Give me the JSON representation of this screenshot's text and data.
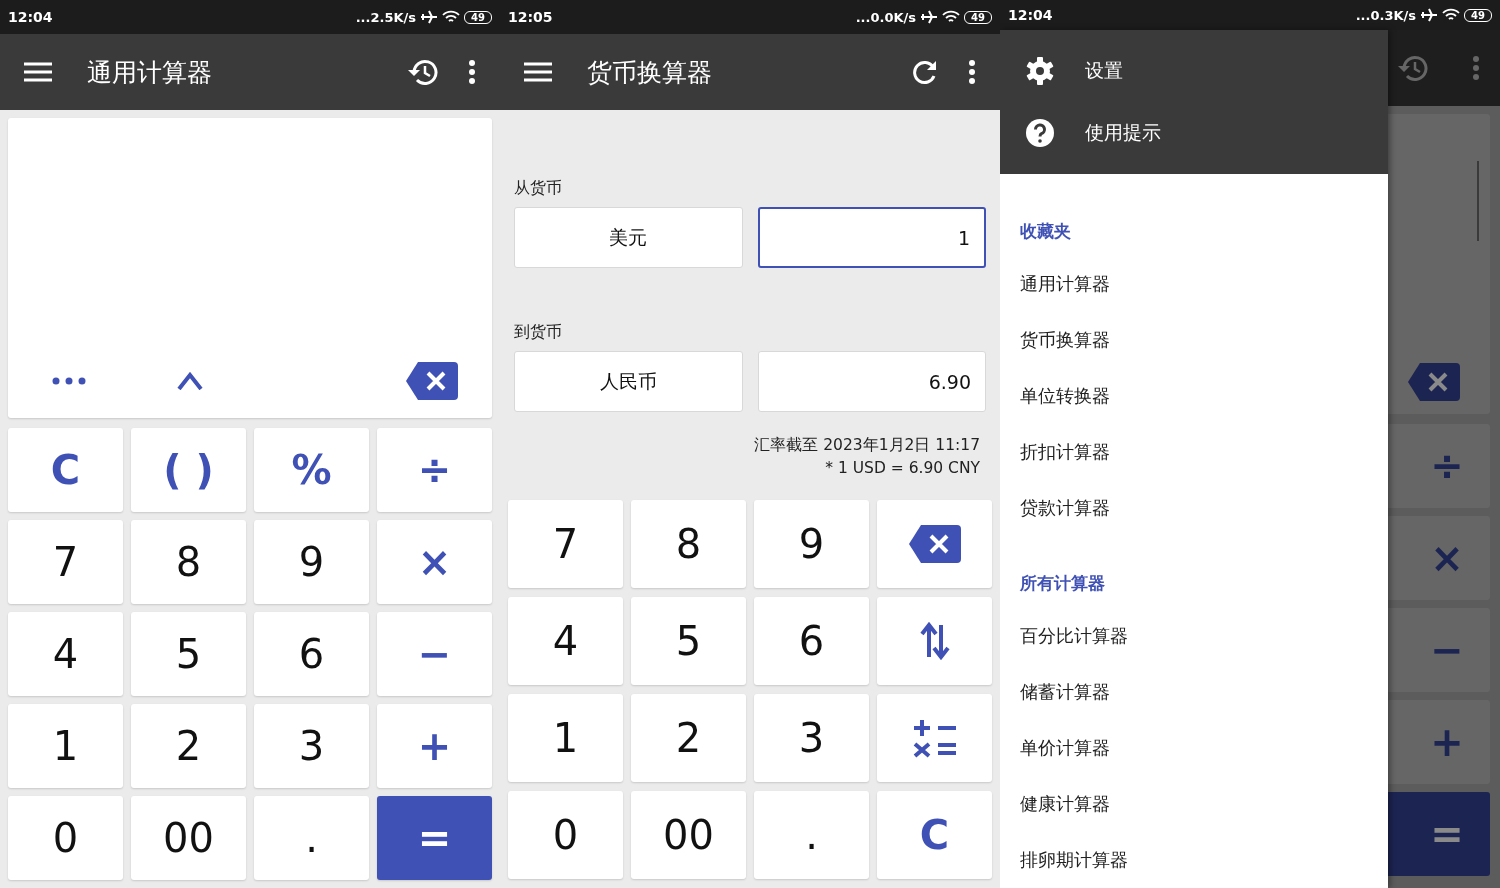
{
  "general_calculator": {
    "status_bar": {
      "time": "12:04",
      "speed": "...2.5K/s",
      "battery": "49"
    },
    "title": "通用计算器",
    "keys": [
      {
        "label": "C",
        "kind": "op"
      },
      {
        "label": "( )",
        "kind": "op"
      },
      {
        "label": "%",
        "kind": "op"
      },
      {
        "label": "÷",
        "kind": "op"
      },
      {
        "label": "7",
        "kind": "digit"
      },
      {
        "label": "8",
        "kind": "digit"
      },
      {
        "label": "9",
        "kind": "digit"
      },
      {
        "label": "×",
        "kind": "op"
      },
      {
        "label": "4",
        "kind": "digit"
      },
      {
        "label": "5",
        "kind": "digit"
      },
      {
        "label": "6",
        "kind": "digit"
      },
      {
        "label": "−",
        "kind": "op"
      },
      {
        "label": "1",
        "kind": "digit"
      },
      {
        "label": "2",
        "kind": "digit"
      },
      {
        "label": "3",
        "kind": "digit"
      },
      {
        "label": "+",
        "kind": "op"
      },
      {
        "label": "0",
        "kind": "digit"
      },
      {
        "label": "00",
        "kind": "digit"
      },
      {
        "label": ".",
        "kind": "digit"
      },
      {
        "label": "=",
        "kind": "equals"
      }
    ]
  },
  "currency_converter": {
    "status_bar": {
      "time": "12:05",
      "speed": "...0.0K/s",
      "battery": "49"
    },
    "title": "货币换算器",
    "pairs": [
      {
        "label": "从货币",
        "currency": "美元",
        "value": "1",
        "focused": true
      },
      {
        "label": "到货币",
        "currency": "人民币",
        "value": "6.90",
        "focused": false
      }
    ],
    "rate_lines": [
      "汇率截至 2023年1月2日 11:17",
      "* 1 USD = 6.90 CNY"
    ],
    "keys": [
      {
        "label": "7",
        "kind": "digit"
      },
      {
        "label": "8",
        "kind": "digit"
      },
      {
        "label": "9",
        "kind": "digit"
      },
      {
        "kind": "backspace"
      },
      {
        "label": "4",
        "kind": "digit"
      },
      {
        "label": "5",
        "kind": "digit"
      },
      {
        "label": "6",
        "kind": "digit"
      },
      {
        "kind": "swap"
      },
      {
        "label": "1",
        "kind": "digit"
      },
      {
        "label": "2",
        "kind": "digit"
      },
      {
        "label": "3",
        "kind": "digit"
      },
      {
        "kind": "operators"
      },
      {
        "label": "0",
        "kind": "digit"
      },
      {
        "label": "00",
        "kind": "digit"
      },
      {
        "label": ".",
        "kind": "digit"
      },
      {
        "label": "C",
        "kind": "op"
      }
    ]
  },
  "drawer_screen": {
    "status_bar": {
      "time": "12:04",
      "speed": "...0.3K/s",
      "battery": "49"
    },
    "header_items": [
      {
        "label": "设置",
        "kind": "settings"
      },
      {
        "label": "使用提示",
        "kind": "help"
      }
    ],
    "sections": [
      {
        "title": "收藏夹",
        "items": [
          "通用计算器",
          "货币换算器",
          "单位转换器",
          "折扣计算器",
          "贷款计算器"
        ]
      },
      {
        "title": "所有计算器",
        "items": [
          "百分比计算器",
          "储蓄计算器",
          "单价计算器",
          "健康计算器",
          "排卵期计算器"
        ]
      }
    ],
    "background_keys": [
      {
        "label": "÷",
        "kind": "op"
      },
      {
        "label": "×",
        "kind": "op"
      },
      {
        "label": "−",
        "kind": "op"
      },
      {
        "label": "+",
        "kind": "op"
      },
      {
        "label": "=",
        "kind": "equals"
      }
    ]
  }
}
